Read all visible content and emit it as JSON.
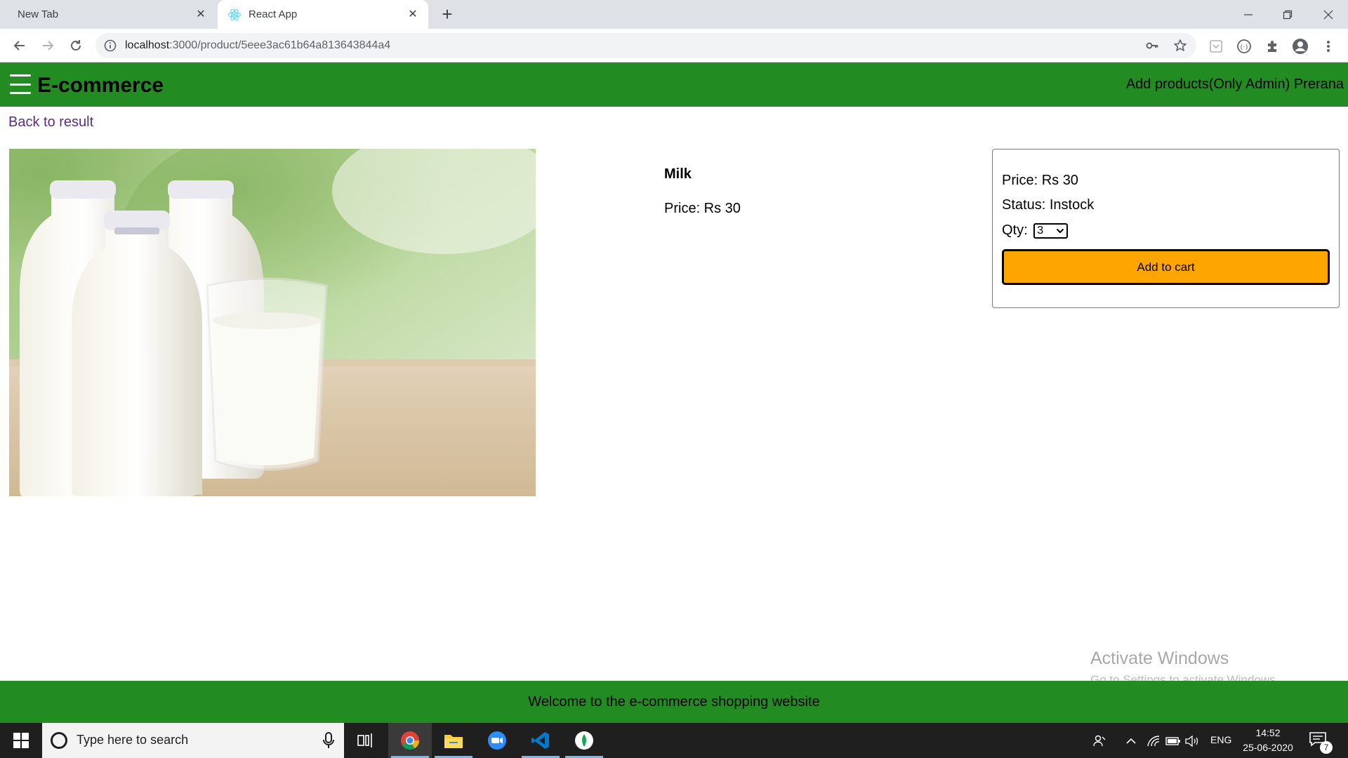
{
  "browser": {
    "tabs": [
      {
        "title": "New Tab",
        "active": false
      },
      {
        "title": "React App",
        "active": true
      }
    ],
    "url_host": "localhost",
    "url_path": ":3000/product/5eee3ac61b64a813643844a4"
  },
  "header": {
    "brand": "E-commerce",
    "links": [
      "Add products(Only Admin)",
      "Prerana"
    ]
  },
  "content": {
    "back_link": "Back to result",
    "product": {
      "name": "Milk",
      "price": "Price: Rs 30",
      "image_alt": "bottles-and-glass-of-milk"
    },
    "action": {
      "price_label": "Price:",
      "price_value": "Rs 30",
      "status_label": "Status:",
      "status_value": "Instock",
      "qty_label": "Qty:",
      "qty_value": "3",
      "add_to_cart": "Add to cart"
    }
  },
  "watermark": {
    "title": "Activate Windows",
    "subtitle": "Go to Settings to activate Windows."
  },
  "footer": {
    "text": "Welcome to the e-commerce shopping website"
  },
  "taskbar": {
    "search_placeholder": "Type here to search",
    "language": "ENG",
    "time": "14:52",
    "date": "25-06-2020",
    "notification_count": "7"
  },
  "colors": {
    "header_green": "#228b22",
    "button_orange": "#ffa500",
    "link_purple": "#5a2d82"
  }
}
